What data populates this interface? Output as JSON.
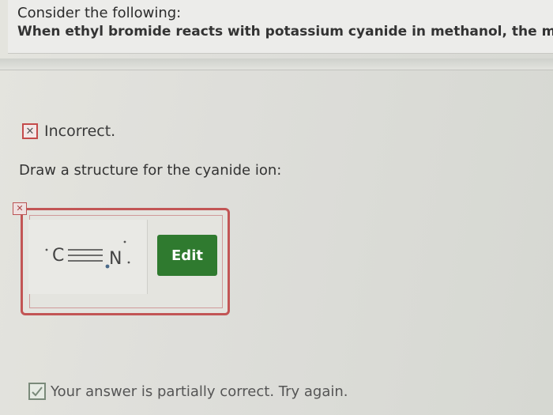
{
  "question": {
    "title": "Consider the following:",
    "text": "When ethyl bromide reacts with potassium cyanide in methanol, the majo"
  },
  "feedback": {
    "status_label": "Incorrect.",
    "partial_label": "Your answer is partially correct.  Try again."
  },
  "prompt": {
    "text": "Draw a structure for the cyanide ion:"
  },
  "structure": {
    "atom_left": "C",
    "atom_right": "N"
  },
  "actions": {
    "edit_label": "Edit"
  },
  "colors": {
    "edit_button": "#2f7a2f",
    "incorrect_border": "#c44b4b"
  },
  "icons": {
    "incorrect": "x-mark-icon",
    "answer_incorrect": "x-mark-icon",
    "partial": "check-mark-icon"
  }
}
